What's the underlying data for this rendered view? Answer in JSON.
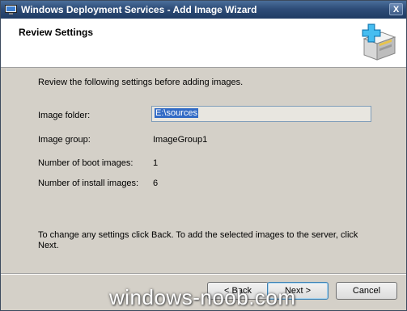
{
  "window": {
    "title": "Windows Deployment Services - Add Image Wizard",
    "close_glyph": "X"
  },
  "header": {
    "title": "Review Settings",
    "icon": "server-add-icon"
  },
  "content": {
    "intro": "Review the following settings before adding images.",
    "image_folder_label": "Image folder:",
    "image_folder_value": "E:\\sources",
    "image_group_label": "Image group:",
    "image_group_value": "ImageGroup1",
    "boot_images_label": "Number of boot images:",
    "boot_images_value": "1",
    "install_images_label": "Number of install images:",
    "install_images_value": "6",
    "footer_note": "To change any settings click Back. To add the selected images to the server, click Next."
  },
  "buttons": {
    "back": "< Back",
    "next": "Next >",
    "cancel": "Cancel"
  },
  "watermark": "windows-noob.com",
  "colors": {
    "titlebar": "#2e4d78",
    "dialog_bg": "#d4d0c8",
    "selection": "#316ac5"
  }
}
